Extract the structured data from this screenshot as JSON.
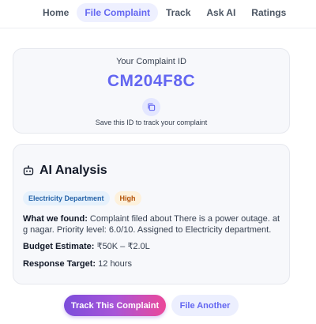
{
  "nav": {
    "items": [
      "Home",
      "File Complaint",
      "Track",
      "Ask AI",
      "Ratings"
    ],
    "active": "File Complaint"
  },
  "complaint": {
    "id_label": "Your Complaint ID",
    "id_value": "CM204F8C",
    "hint": "Save this ID to track your complaint"
  },
  "analysis": {
    "title": "AI Analysis",
    "department_badge": "Electricity Department",
    "priority_badge": "High",
    "found_label": "What we found:",
    "found_text": " Complaint filed about There is a power outage. at g nagar. Priority level: 6.0/10. Assigned to Electricity department.",
    "budget_label": "Budget Estimate:",
    "budget_value": " ₹50K – ₹2.0L",
    "response_label": "Response Target:",
    "response_value": " 12 hours"
  },
  "actions": {
    "track_label": "Track This Complaint",
    "file_another_label": "File Another"
  },
  "colors": {
    "accent": "#6366f1",
    "department_badge_bg": "#e6f1fc",
    "priority_badge_bg": "#fdf1dc"
  },
  "icons": {
    "copy": "copy-icon",
    "analysis": "robot-icon"
  }
}
